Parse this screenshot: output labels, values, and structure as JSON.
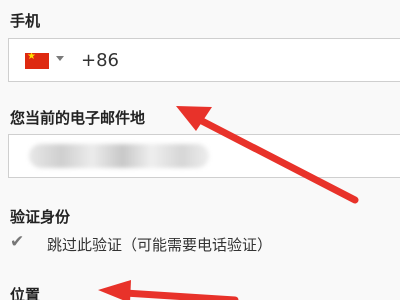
{
  "phone": {
    "label": "手机",
    "country_flag": "china-flag-icon",
    "value": "+86"
  },
  "email": {
    "label": "您当前的电子邮件地",
    "value_state": "blurred"
  },
  "verification": {
    "label": "验证身份",
    "skip_checked": true,
    "skip_label": "跳过此验证（可能需要电话验证）"
  },
  "location": {
    "label": "位置"
  },
  "colors": {
    "annotation_arrow": "#e8322a",
    "flag_red": "#de2910",
    "flag_star": "#ffde00"
  }
}
